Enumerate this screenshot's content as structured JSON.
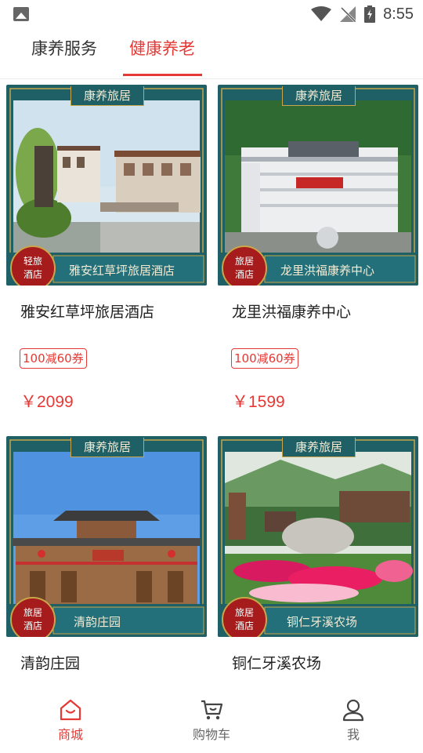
{
  "status_bar": {
    "time": "8:55"
  },
  "tabs": [
    {
      "label": "康养服务",
      "active": false
    },
    {
      "label": "健康养老",
      "active": true
    }
  ],
  "colors": {
    "accent": "#e53935",
    "banner_teal": "#1f5f66",
    "banner_red": "#b71c1c"
  },
  "products": [
    {
      "name": "雅安红草坪旅居酒店",
      "badge_top": "康养旅居",
      "badge_seal": "轻旅\n酒店",
      "banner_name": "雅安红草坪旅居酒店",
      "coupon": "100减60券",
      "price": "￥2099"
    },
    {
      "name": "龙里洪福康养中心",
      "badge_top": "康养旅居",
      "badge_seal": "旅居\n酒店",
      "banner_name": "龙里洪福康养中心",
      "coupon": "100减60券",
      "price": "￥1599"
    },
    {
      "name": "清韵庄园",
      "badge_top": "康养旅居",
      "badge_seal": "旅居\n酒店",
      "banner_name": "清韵庄园",
      "coupon": "",
      "price": ""
    },
    {
      "name": "铜仁牙溪农场",
      "badge_top": "康养旅居",
      "badge_seal": "旅居\n酒店",
      "banner_name": "铜仁牙溪农场",
      "coupon": "",
      "price": ""
    }
  ],
  "bottom_nav": [
    {
      "label": "商城",
      "icon": "home-icon",
      "active": true
    },
    {
      "label": "购物车",
      "icon": "cart-icon",
      "active": false
    },
    {
      "label": "我",
      "icon": "user-icon",
      "active": false
    }
  ]
}
